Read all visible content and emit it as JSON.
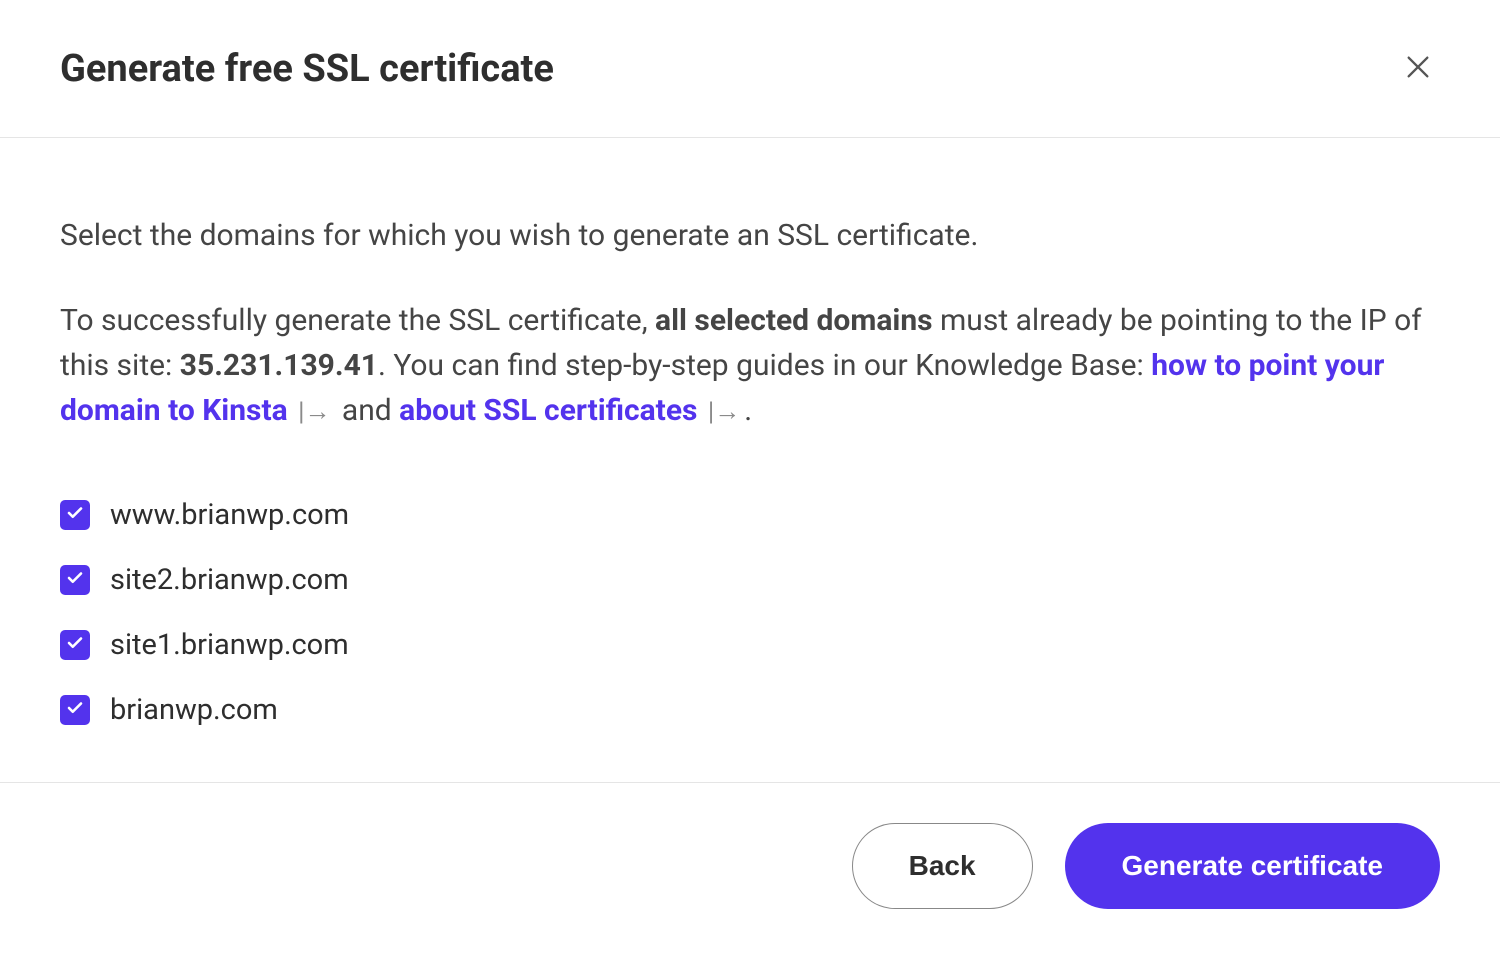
{
  "header": {
    "title": "Generate free SSL certificate"
  },
  "body": {
    "intro": "Select the domains for which you wish to generate an SSL certificate.",
    "guide_prefix": "To successfully generate the SSL certificate, ",
    "guide_emphasis": "all selected domains",
    "guide_mid1": " must already be pointing to the IP of this site: ",
    "ip_address": "35.231.139.41",
    "guide_mid2": ". You can find step-by-step guides in our Knowledge Base: ",
    "link1": "how to point your domain to Kinsta",
    "guide_and": " and ",
    "link2": "about SSL certificates",
    "guide_period": ".",
    "domains": [
      {
        "label": "www.brianwp.com",
        "checked": true
      },
      {
        "label": "site2.brianwp.com",
        "checked": true
      },
      {
        "label": "site1.brianwp.com",
        "checked": true
      },
      {
        "label": "brianwp.com",
        "checked": true
      }
    ]
  },
  "footer": {
    "back_label": "Back",
    "generate_label": "Generate certificate"
  }
}
